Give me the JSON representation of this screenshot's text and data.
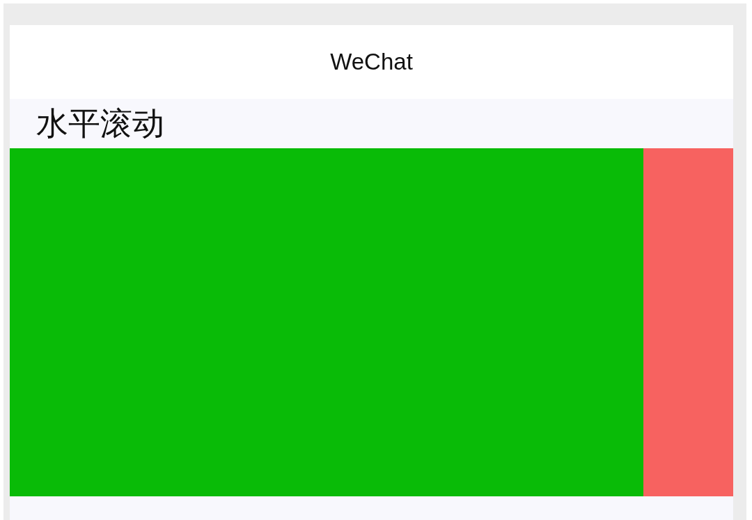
{
  "nav_bar": {
    "title": "WeChat"
  },
  "section": {
    "title": "水平滚动"
  },
  "scroll_items": [
    {
      "color": "#09bb07"
    },
    {
      "color": "#f76260"
    }
  ]
}
